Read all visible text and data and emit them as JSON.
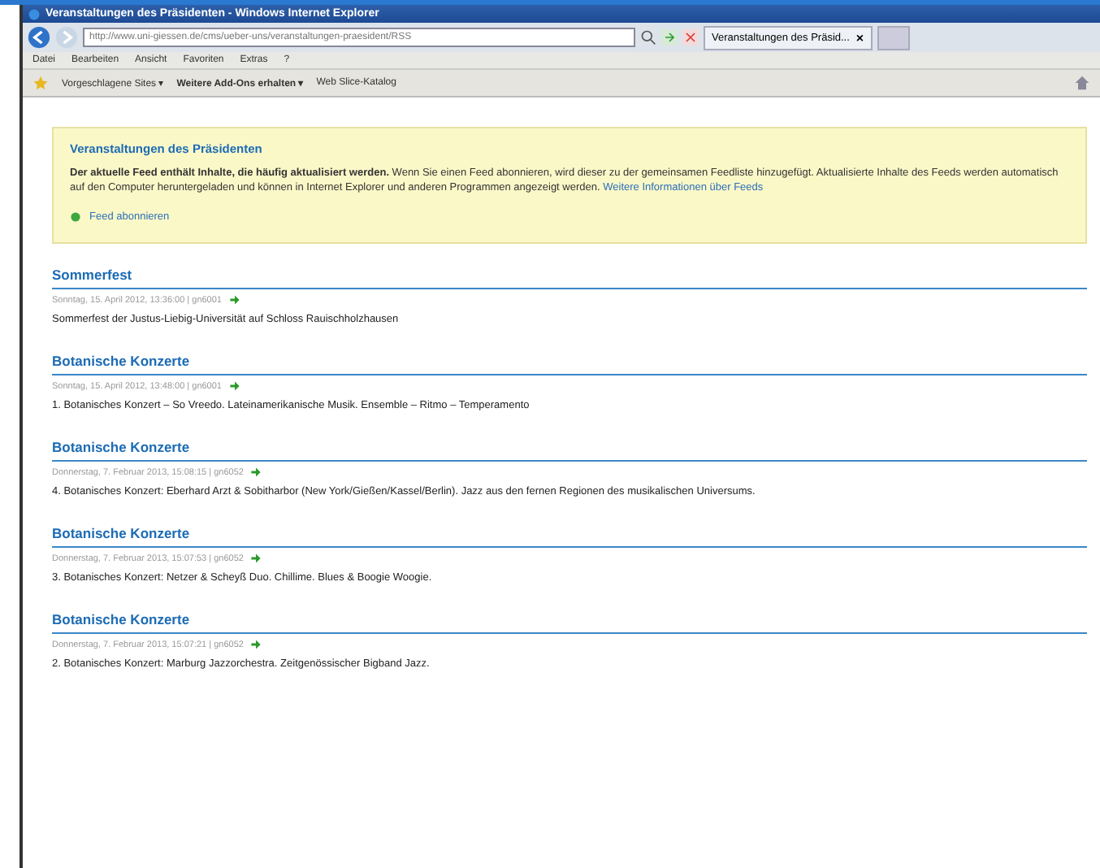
{
  "window": {
    "title": "Veranstaltungen des Präsidenten - Windows Internet Explorer"
  },
  "address_bar": {
    "url": "http://www.uni-giessen.de/cms/ueber-uns/veranstaltungen-praesident/RSS"
  },
  "tab": {
    "label": "Veranstaltungen des Präsid...",
    "close": "×"
  },
  "menu": [
    "Datei",
    "Bearbeiten",
    "Ansicht",
    "Favoriten",
    "Extras",
    "?"
  ],
  "favorites_bar": [
    {
      "label": "Vorgeschlagene Sites ▾"
    },
    {
      "label": "Weitere Add-Ons erhalten ▾"
    },
    {
      "label": "Web Slice-Katalog"
    }
  ],
  "feed_info": {
    "title": "Veranstaltungen des Präsidenten",
    "text": "**Der aktuelle Feed enthält Inhalte, die häufig aktualisiert werden.** Wenn Sie einen Feed abonnieren, wird dieser zu der gemeinsamen Feedliste hinzugefügt. Aktualisierte Inhalte des Feeds werden automatisch auf den Computer heruntergeladen und können in Internet Explorer und anderen Programmen angezeigt werden.",
    "link": "Weitere Informationen über Feeds",
    "subscribe": "Feed abonnieren"
  },
  "entries": [
    {
      "title": "Sommerfest",
      "meta": "Sonntag, 15. April 2012, 13:36:00 | gn6001",
      "text": "Sommerfest der Justus-Liebig-Universität auf Schloss Rauischholzhausen"
    },
    {
      "title": "Botanische Konzerte",
      "meta": "Sonntag, 15. April 2012, 13:48:00 | gn6001",
      "text": "1. Botanisches Konzert – So Vreedo. Lateinamerikanische Musik. Ensemble – Ritmo – Temperamento"
    },
    {
      "title": "Botanische Konzerte",
      "meta": "Donnerstag, 7. Februar 2013, 15:08:15 | gn6052",
      "text": "4. Botanisches Konzert: Eberhard Arzt & Sobitharbor (New York/Gießen/Kassel/Berlin). Jazz aus den fernen Regionen des musikalischen Universums."
    },
    {
      "title": "Botanische Konzerte",
      "meta": "Donnerstag, 7. Februar 2013, 15:07:53 | gn6052",
      "text": "3. Botanisches Konzert: Netzer & Scheyß Duo. Chillime. Blues & Boogie Woogie."
    },
    {
      "title": "Botanische Konzerte",
      "meta": "Donnerstag, 7. Februar 2013, 15:07:21 | gn6052",
      "text": "2. Botanisches Konzert: Marburg Jazzorchestra. Zeitgenössischer Bigband Jazz."
    }
  ]
}
